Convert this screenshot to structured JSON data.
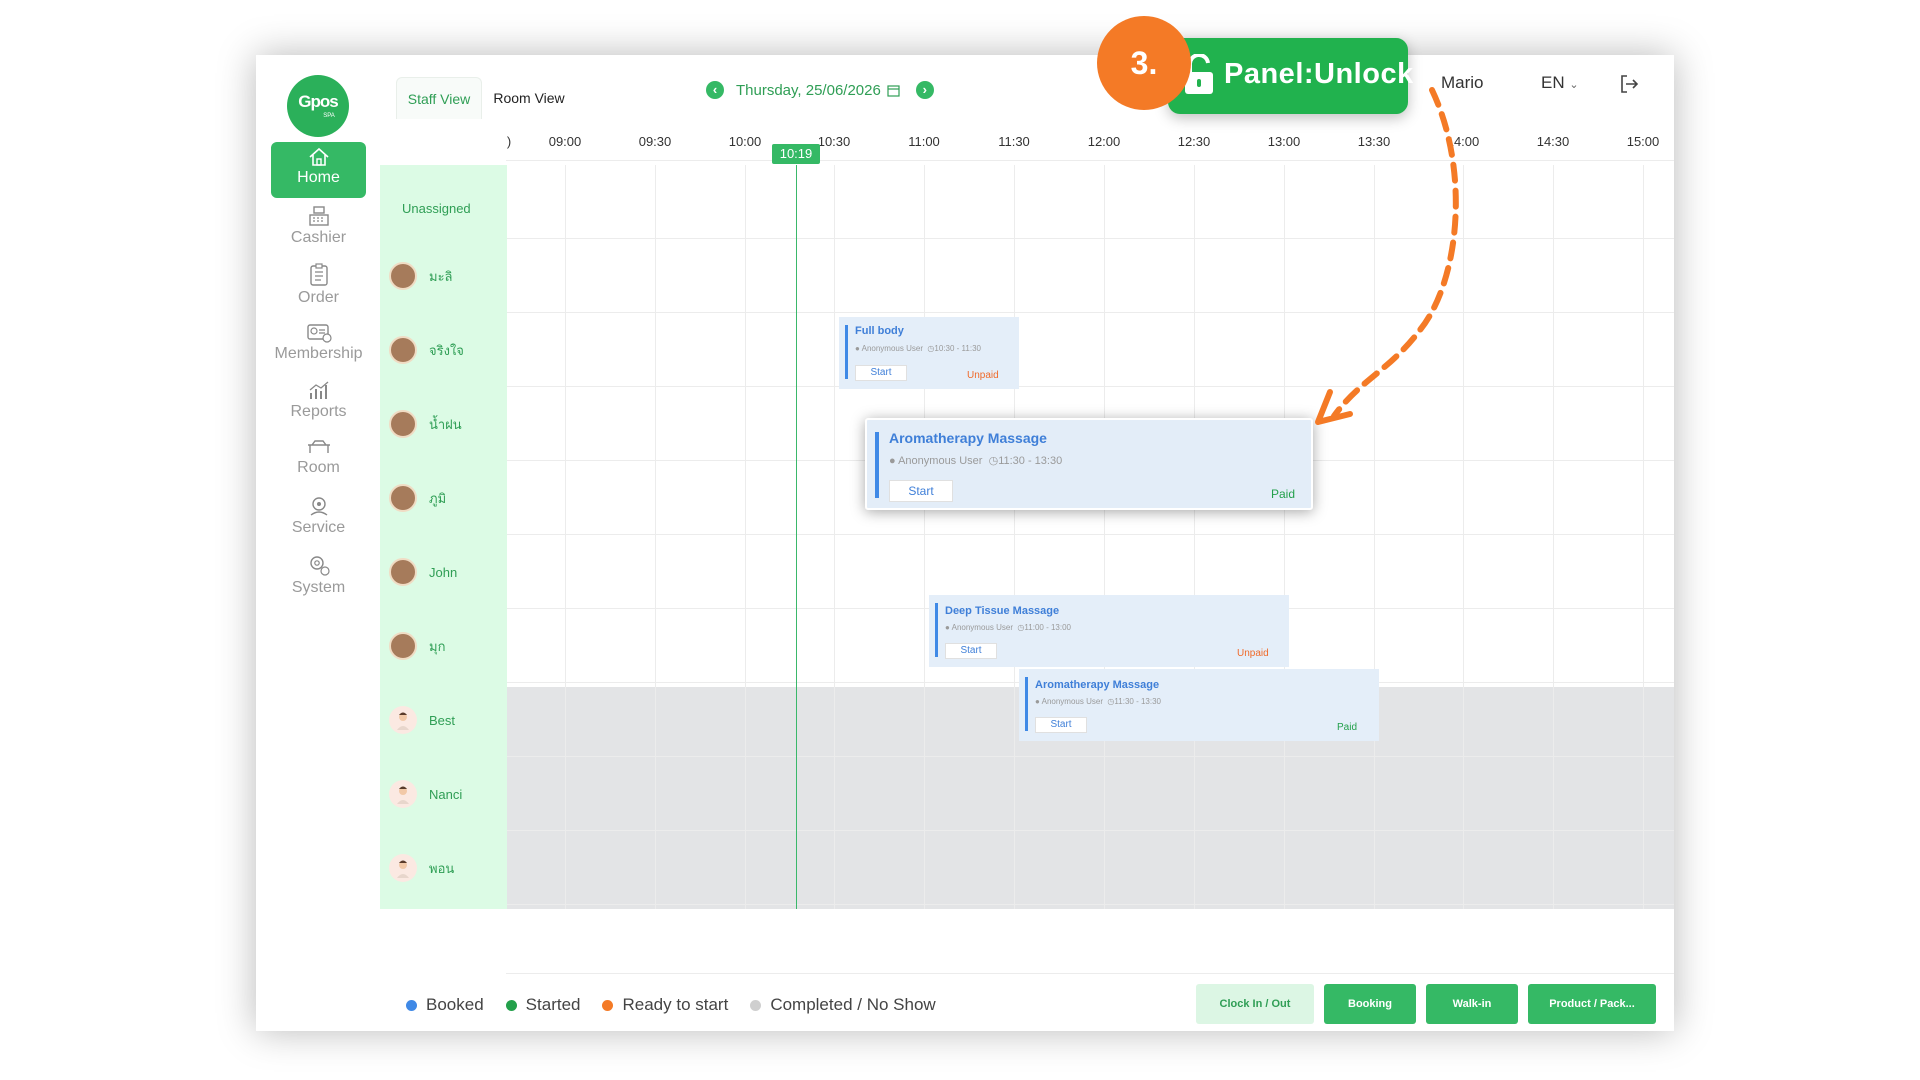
{
  "sidebar": {
    "logo_text": "Gpos",
    "logo_sub": "SPA",
    "items": [
      {
        "label": "Home",
        "icon": "home-icon",
        "active": true
      },
      {
        "label": "Cashier",
        "icon": "cashier-icon",
        "active": false
      },
      {
        "label": "Order",
        "icon": "order-icon",
        "active": false
      },
      {
        "label": "Membership",
        "icon": "membership-icon",
        "active": false
      },
      {
        "label": "Reports",
        "icon": "reports-icon",
        "active": false
      },
      {
        "label": "Room",
        "icon": "room-icon",
        "active": false
      },
      {
        "label": "Service",
        "icon": "service-icon",
        "active": false
      },
      {
        "label": "System",
        "icon": "system-icon",
        "active": false
      }
    ]
  },
  "header": {
    "tabs": [
      {
        "label": "Staff View",
        "active": true
      },
      {
        "label": "Room View",
        "active": false
      }
    ],
    "date": "Thursday, 25/06/2026",
    "user": "Mario",
    "language": "EN",
    "current_time": "10:19"
  },
  "timeline": {
    "ticks": [
      ")",
      "09:00",
      "09:30",
      "10:00",
      "10:30",
      "11:00",
      "11:30",
      "12:00",
      "12:30",
      "13:00",
      "13:30",
      "14:00",
      "14:30",
      "15:00"
    ]
  },
  "staff": {
    "unassigned_label": "Unassigned",
    "members": [
      {
        "name": "มะลิ",
        "available": true
      },
      {
        "name": "จริงใจ",
        "available": true
      },
      {
        "name": "น้ำฝน",
        "available": true
      },
      {
        "name": "ภูมิ",
        "available": true
      },
      {
        "name": "John",
        "available": true
      },
      {
        "name": "มุก",
        "available": true
      },
      {
        "name": "Best",
        "available": false
      },
      {
        "name": "Nanci",
        "available": false
      },
      {
        "name": "พอน",
        "available": false
      }
    ]
  },
  "appointments": [
    {
      "title": "Full body",
      "customer": "Anonymous User",
      "time": "10:30 - 11:30",
      "action": "Start",
      "payment": "Unpaid"
    },
    {
      "title": "Aromatherapy Massage",
      "customer": "Anonymous User",
      "time": "11:30 - 13:30",
      "action": "Start",
      "payment": "Paid"
    },
    {
      "title": "Deep Tissue Massage",
      "customer": "Anonymous User",
      "time": "11:00 - 13:00",
      "action": "Start",
      "payment": "Unpaid"
    },
    {
      "title": "Aromatherapy Massage",
      "customer": "Anonymous User",
      "time": "11:30 - 13:30",
      "action": "Start",
      "payment": "Paid"
    }
  ],
  "legend": [
    {
      "label": "Booked",
      "color": "#3f89e6"
    },
    {
      "label": "Started",
      "color": "#23a04b"
    },
    {
      "label": "Ready to start",
      "color": "#f47a26"
    },
    {
      "label": "Completed / No Show",
      "color": "#cfcfcf"
    }
  ],
  "actions": {
    "clock": "Clock In / Out",
    "booking": "Booking",
    "walkin": "Walk-in",
    "product": "Product / Pack..."
  },
  "callout": {
    "step": "3.",
    "label": "Panel:Unlock"
  },
  "colors": {
    "brand_green": "#35b965",
    "booked_blue": "#3f89e6",
    "unpaid": "#f06a2a",
    "callout_orange": "#f47a26"
  }
}
